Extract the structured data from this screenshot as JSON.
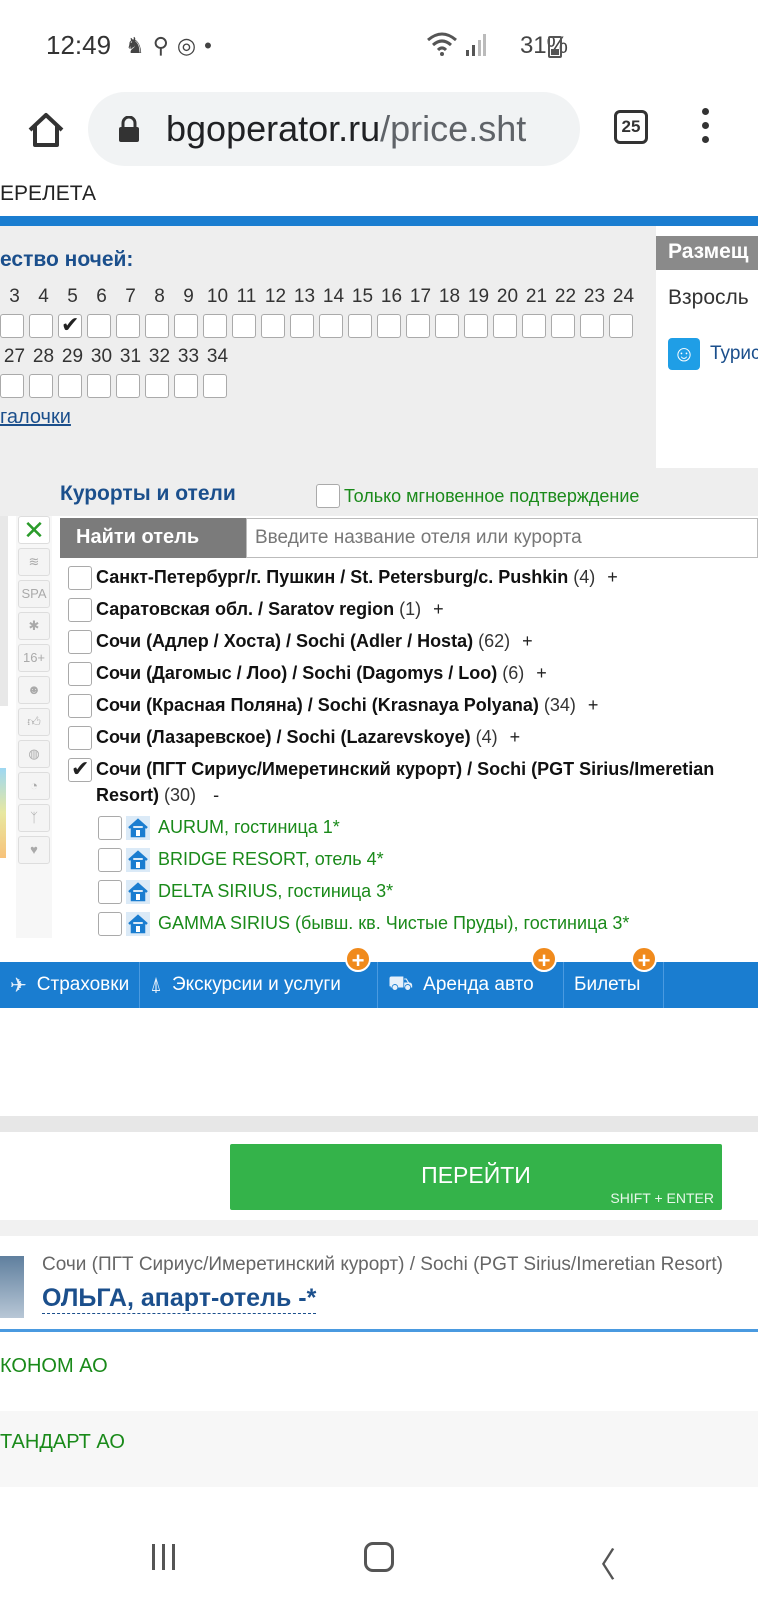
{
  "status_bar": {
    "time": "12:49",
    "battery": "31%",
    "icons": [
      "accessibility-icon",
      "search-icon",
      "instagram-icon",
      "dot-icon",
      "wifi-icon",
      "signal-icon",
      "battery-icon"
    ]
  },
  "browser": {
    "url_domain": "bgoperator.ru",
    "url_path": "/price.sht",
    "tab_count": "25"
  },
  "page": {
    "top_label": "ЕРЕЛЕТА",
    "nights": {
      "title": "ество ночей:",
      "row1": [
        "3",
        "4",
        "5",
        "6",
        "7",
        "8",
        "9",
        "10",
        "11",
        "12",
        "13",
        "14",
        "15",
        "16",
        "17",
        "18",
        "19",
        "20",
        "21",
        "22",
        "23",
        "24"
      ],
      "row2": [
        "27",
        "28",
        "29",
        "30",
        "31",
        "32",
        "33",
        "34"
      ],
      "checked": "5",
      "clear_link": "галочки"
    },
    "accommodation": {
      "header": "Размещ",
      "adults": "Взросль",
      "tourist": "Турис"
    },
    "resorts": {
      "title": "Курорты и отели",
      "instant_label": "Только мгновенное подтверждение",
      "search_button": "Найти отель",
      "search_placeholder": "Введите название отеля или курорта",
      "filter_icons": [
        "clear-filters-icon",
        "beach-icon",
        "spa-icon",
        "medical-icon",
        "age-16-icon",
        "kids-icon",
        "thumbs-up-icon",
        "ball-icon",
        "family-icon",
        "fitness-icon",
        "heart-icon"
      ],
      "items": [
        {
          "name": "Санкт-Петербург/г. Пушкин / St. Petersburg/c. Pushkin",
          "count": "(4)",
          "toggle": "+"
        },
        {
          "name": "Саратовская обл. / Saratov region",
          "count": "(1)",
          "toggle": "+"
        },
        {
          "name": "Сочи (Адлер / Хоста) / Sochi (Adler / Hosta)",
          "count": "(62)",
          "toggle": "+"
        },
        {
          "name": "Сочи (Дагомыс / Лоо) / Sochi (Dagomys / Loo)",
          "count": "(6)",
          "toggle": "+"
        },
        {
          "name": "Сочи (Красная Поляна) / Sochi (Krasnaya Polyana)",
          "count": "(34)",
          "toggle": "+"
        },
        {
          "name": "Сочи (Лазаревское) / Sochi (Lazarevskoye)",
          "count": "(4)",
          "toggle": "+"
        }
      ],
      "expanded": {
        "name_line1": "Сочи (ПГТ Сириус/Имеретинский курорт) / Sochi (PGT Sirius/Imeretian",
        "name_line2": "Resort)",
        "count": "(30)",
        "toggle": "-"
      },
      "hotels": [
        "AURUM, гостиница 1*",
        "BRIDGE RESORT, отель 4*",
        "DELTA SIRIUS, гостиница 3*",
        "GAMMA SIRIUS (бывш. кв. Чистые Пруды), гостиница 3*"
      ]
    },
    "services": [
      {
        "label": "Страховки",
        "icon": "plane-icon",
        "plus": false
      },
      {
        "label": "Экскурсии и услуги",
        "icon": "eiffel-tower-icon",
        "plus": true
      },
      {
        "label": "Аренда авто",
        "icon": "rent-car-icon",
        "plus": true
      },
      {
        "label": "Билеты",
        "icon": "",
        "plus": true
      }
    ],
    "go_button": {
      "label": "ПЕРЕЙТИ",
      "hint": "SHIFT + ENTER"
    },
    "result": {
      "region": "Сочи (ПГТ Сириус/Имеретинский курорт) / Sochi (PGT Sirius/Imeretian Resort)",
      "hotel": "ОЛЬГА, апарт-отель -*",
      "rooms": [
        "КОНОМ АО",
        "ТАНДАРТ АО"
      ]
    }
  },
  "colors": {
    "brand_blue": "#1a7dd0",
    "link_blue": "#1b4f8c",
    "green": "#34b34a",
    "orange_badge": "#f08a1c"
  }
}
